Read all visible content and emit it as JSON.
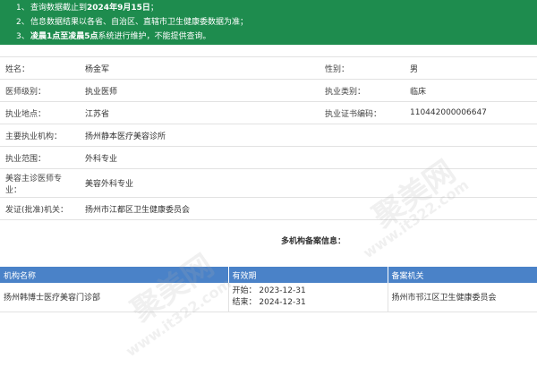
{
  "notice": [
    {
      "num": "1、",
      "pre": "查询数据截止到",
      "bold": "2024年9月15日",
      "post": "；"
    },
    {
      "num": "2、",
      "pre": "信息数据结果以各省、自治区、直辖市卫生健康委数据为准；",
      "bold": "",
      "post": ""
    },
    {
      "num": "3、",
      "pre": "",
      "bold": "凌晨1点至凌晨5点",
      "post": "系统进行维护，不能提供查询。"
    }
  ],
  "doctor": {
    "name_label": "姓名：",
    "name": "杨金军",
    "gender_label": "性别：",
    "gender": "男",
    "level_label": "医师级别：",
    "level": "执业医师",
    "category_label": "执业类别：",
    "category": "临床",
    "location_label": "执业地点：",
    "location": "江苏省",
    "cert_label": "执业证书编码：",
    "cert": "110442000006647",
    "org_label": "主要执业机构：",
    "org": "扬州静本医疗美容诊所",
    "scope_label": "执业范围：",
    "scope": "外科专业",
    "cosmetic_label": "美容主诊医师专业：",
    "cosmetic": "美容外科专业",
    "issuer_label": "发证(批准)机关：",
    "issuer": "扬州市江都区卫生健康委员会"
  },
  "multi_title": "多机构备案信息：",
  "multi_table": {
    "headers": [
      "机构名称",
      "有效期",
      "备案机关"
    ],
    "rows": [
      {
        "org": "扬州韩博士医疗美容门诊部",
        "start": "开始：  2023-12-31",
        "end": "结束：  2024-12-31",
        "authority": "扬州市邗江区卫生健康委员会"
      }
    ]
  },
  "watermark": {
    "brand": "聚美网",
    "url": "www.it322.com"
  }
}
